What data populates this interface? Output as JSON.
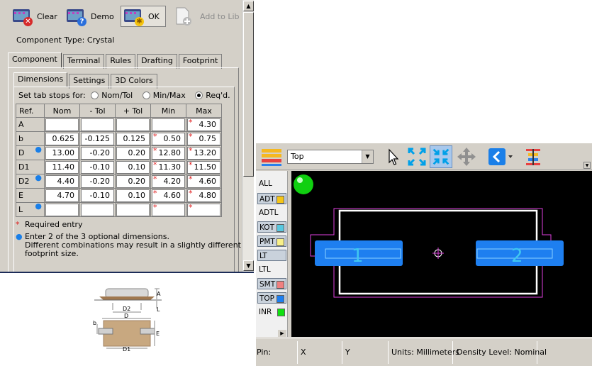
{
  "toolbar": {
    "clear_label": "Clear",
    "demo_label": "Demo",
    "ok_label": "OK",
    "add_to_lib_label": "Add to Lib"
  },
  "component_type": "Component Type: Crystal",
  "main_tabs": [
    "Component",
    "Terminal",
    "Rules",
    "Drafting",
    "Footprint"
  ],
  "sub_tabs": [
    "Dimensions",
    "Settings",
    "3D Colors"
  ],
  "tab_stops": {
    "label": "Set tab stops for:",
    "options": [
      "Nom/Tol",
      "Min/Max",
      "Req'd."
    ],
    "selected": "Req'd."
  },
  "table": {
    "headers": [
      "Ref.",
      "Nom",
      "- Tol",
      "+ Tol",
      "Min",
      "Max"
    ],
    "rows": [
      {
        "ref": "A",
        "nom": "",
        "mtol": "",
        "ptol": "",
        "min": "",
        "max": "4.30"
      },
      {
        "ref": "b",
        "nom": "0.625",
        "mtol": "-0.125",
        "ptol": "0.125",
        "min": "0.50",
        "max": "0.75"
      },
      {
        "ref": "D",
        "nom": "13.00",
        "mtol": "-0.20",
        "ptol": "0.20",
        "min": "12.80",
        "max": "13.20"
      },
      {
        "ref": "D1",
        "nom": "11.40",
        "mtol": "-0.10",
        "ptol": "0.10",
        "min": "11.30",
        "max": "11.50"
      },
      {
        "ref": "D2",
        "nom": "4.40",
        "mtol": "-0.20",
        "ptol": "0.20",
        "min": "4.20",
        "max": "4.60"
      },
      {
        "ref": "E",
        "nom": "4.70",
        "mtol": "-0.10",
        "ptol": "0.10",
        "min": "4.60",
        "max": "4.80"
      },
      {
        "ref": "L",
        "nom": "",
        "mtol": "",
        "ptol": "",
        "min": "",
        "max": ""
      }
    ]
  },
  "notes": {
    "required": "Required entry",
    "optional_line1": "Enter 2 of the 3 optional dimensions.",
    "optional_line2": "Different combinations may result in a slightly different",
    "optional_line3": "footprint size."
  },
  "drawing_labels": {
    "A": "A",
    "L": "L",
    "D2": "D2",
    "D": "D",
    "b": "b",
    "E": "E",
    "D1": "D1"
  },
  "layer_select": "Top",
  "layers": [
    "ALL",
    "ADT",
    "ADTL",
    "KOT",
    "PMT",
    "LT",
    "LTL",
    "SMT",
    "TOP",
    "INR"
  ],
  "layer_colors": {
    "ADT": "#f5c518",
    "KOT": "#58c8e0",
    "PMT": "#f8f088",
    "LT": "#d0d8ec",
    "SMT": "#f08080",
    "TOP": "#1e7ff0",
    "INR": "#10e010"
  },
  "pads": [
    "1",
    "2"
  ],
  "status": {
    "pin": "Pin:",
    "x": "X",
    "y": "Y",
    "units": "Units: Millimeters",
    "density": "Density Level: Nominal"
  },
  "colors": {
    "pad": "#1e7ff0",
    "courtyard": "#e040e0",
    "silkscreen": "#ffffff",
    "accent": "#00a0e8"
  }
}
